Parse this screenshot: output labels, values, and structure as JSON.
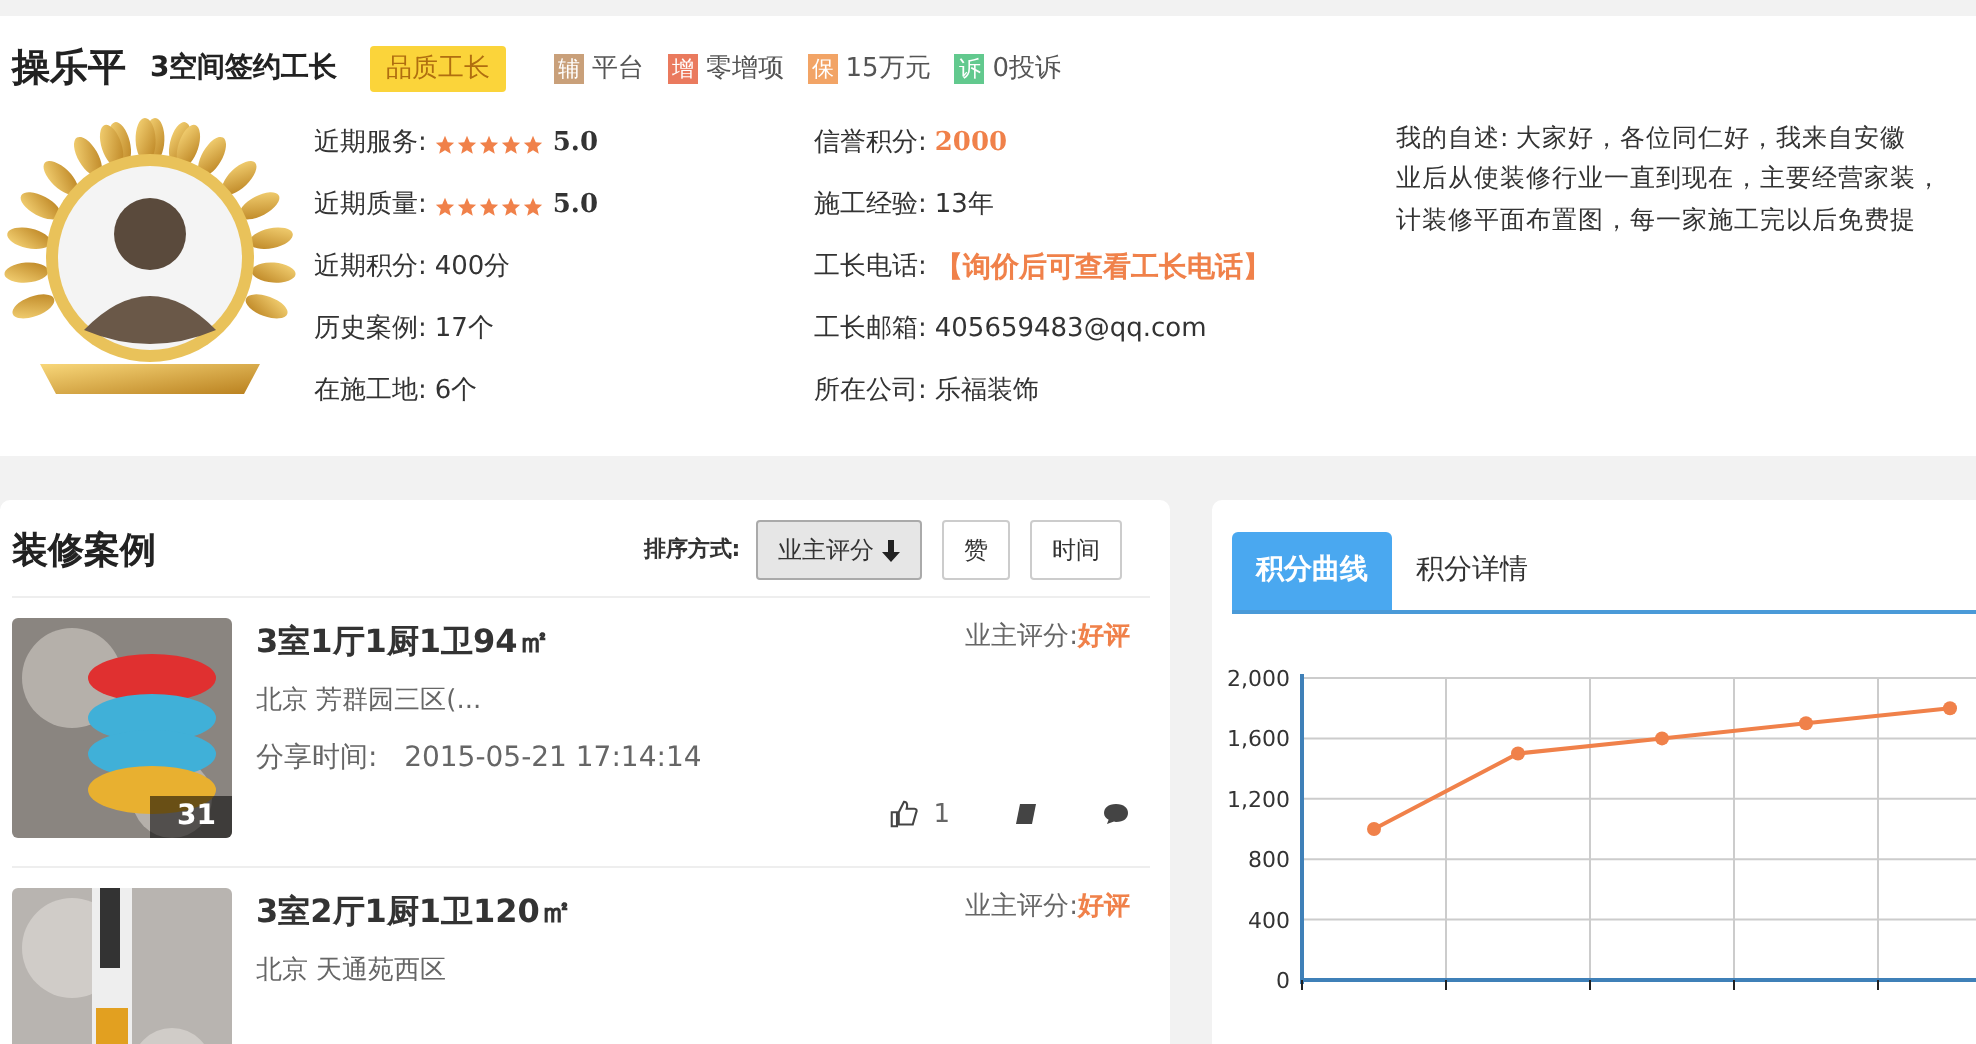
{
  "profile": {
    "name": "操乐平",
    "subtitle": "3空间签约工长",
    "level_badge": "品质工长",
    "tags": [
      {
        "icon": "辅",
        "text": "平台",
        "color": "#c9a07a"
      },
      {
        "icon": "增",
        "text": "零增项",
        "color": "#ea7a5e"
      },
      {
        "icon": "保",
        "text": "15万元",
        "color": "#f2a466"
      },
      {
        "icon": "诉",
        "text": "0投诉",
        "color": "#62c98e"
      }
    ],
    "stats": [
      {
        "label": "近期服务:",
        "kind": "stars",
        "stars": 5,
        "value": "5.0"
      },
      {
        "label": "近期质量:",
        "kind": "stars",
        "stars": 5,
        "value": "5.0"
      },
      {
        "label": "近期积分:",
        "kind": "text",
        "value": "400分"
      },
      {
        "label": "历史案例:",
        "kind": "text",
        "value": "17个"
      },
      {
        "label": "在施工地:",
        "kind": "text",
        "value": "6个"
      }
    ],
    "details": [
      {
        "label": "信誉积分:",
        "kind": "score",
        "value": "2000"
      },
      {
        "label": "施工经验:",
        "kind": "text",
        "value": "13年"
      },
      {
        "label": "工长电话:",
        "kind": "highlight",
        "value": "【询价后可查看工长电话】"
      },
      {
        "label": "工长邮箱:",
        "kind": "text",
        "value": "405659483@qq.com"
      },
      {
        "label": "所在公司:",
        "kind": "text",
        "value": "乐福装饰"
      }
    ],
    "intro_lines": [
      "我的自述: 大家好，各位同仁好，我来自安徽",
      "业后从使装修行业一直到现在，主要经营家装，",
      "计装修平面布置图，每一家施工完以后免费提"
    ]
  },
  "cases": {
    "title": "装修案例",
    "sort_label": "排序方式:",
    "sort_buttons": [
      {
        "label": "业主评分",
        "selected": true
      },
      {
        "label": "赞",
        "selected": false
      },
      {
        "label": "时间",
        "selected": false
      }
    ],
    "items": [
      {
        "title": "3室1厅1厨1卫94㎡",
        "rating_label": "业主评分:",
        "rating": "好评",
        "location": "北京 芳群园三区(...",
        "share_label": "分享时间:",
        "share_time": "2015-05-21 17:14:14",
        "photo_count": "31",
        "likes": "1"
      },
      {
        "title": "3室2厅1厨1卫120㎡",
        "rating_label": "业主评分:",
        "rating": "好评",
        "location": "北京 天通苑西区"
      }
    ]
  },
  "score_panel": {
    "tabs": [
      {
        "label": "积分曲线",
        "selected": true
      },
      {
        "label": "积分详情",
        "selected": false
      }
    ],
    "chart_data": {
      "type": "line",
      "grid": true,
      "ylim": [
        0,
        2000
      ],
      "yticks": [
        {
          "value": 0,
          "label": "0"
        },
        {
          "value": 400,
          "label": "400"
        },
        {
          "value": 800,
          "label": "800"
        },
        {
          "value": 1200,
          "label": "1,200"
        },
        {
          "value": 1600,
          "label": "1,600"
        },
        {
          "value": 2000,
          "label": "2,000"
        }
      ],
      "series": [
        {
          "color": "#f0814a",
          "marker": true,
          "values": [
            1000,
            1500,
            1600,
            1700,
            1800
          ]
        }
      ]
    }
  }
}
